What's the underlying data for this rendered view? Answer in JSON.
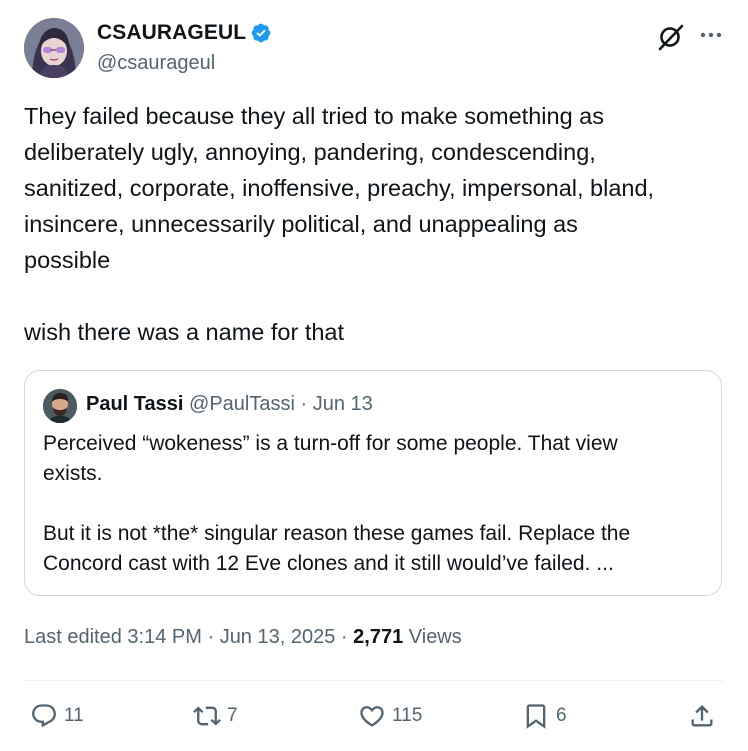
{
  "author": {
    "display_name": "CSAURAGEUL",
    "handle": "@csaurageul",
    "verified": true,
    "verified_color": "#1d9bf0",
    "avatar_icon": "anime-character-avatar"
  },
  "tweet": {
    "text": "They failed because they all tried to make something as\ndeliberately ugly, annoying, pandering, condescending,\nsanitized, corporate, inoffensive, preachy, impersonal, bland,\ninsincere, unnecessarily political, and unappealing as\npossible\n\nwish there was a name for that"
  },
  "quote": {
    "name": "Paul Tassi",
    "handle": "@PaulTassi",
    "separator": "·",
    "date": "Jun 13",
    "text": "Perceived “wokeness” is a turn-off for some people. That view\nexists.\n\nBut it is not *the* singular reason these games fail. Replace the\nConcord cast with 12 Eve clones and it still would’ve failed. ..."
  },
  "meta": {
    "edited_label": "Last edited 3:14 PM",
    "separator": "·",
    "date": "Jun 13, 2025",
    "views_count": "2,771",
    "views_label": "Views"
  },
  "actions": {
    "replies": "11",
    "reposts": "7",
    "likes": "115",
    "bookmarks": "6"
  },
  "colors": {
    "text_primary": "#0f1419",
    "text_secondary": "#536471",
    "border": "#cfd9de",
    "accent": "#1d9bf0"
  }
}
